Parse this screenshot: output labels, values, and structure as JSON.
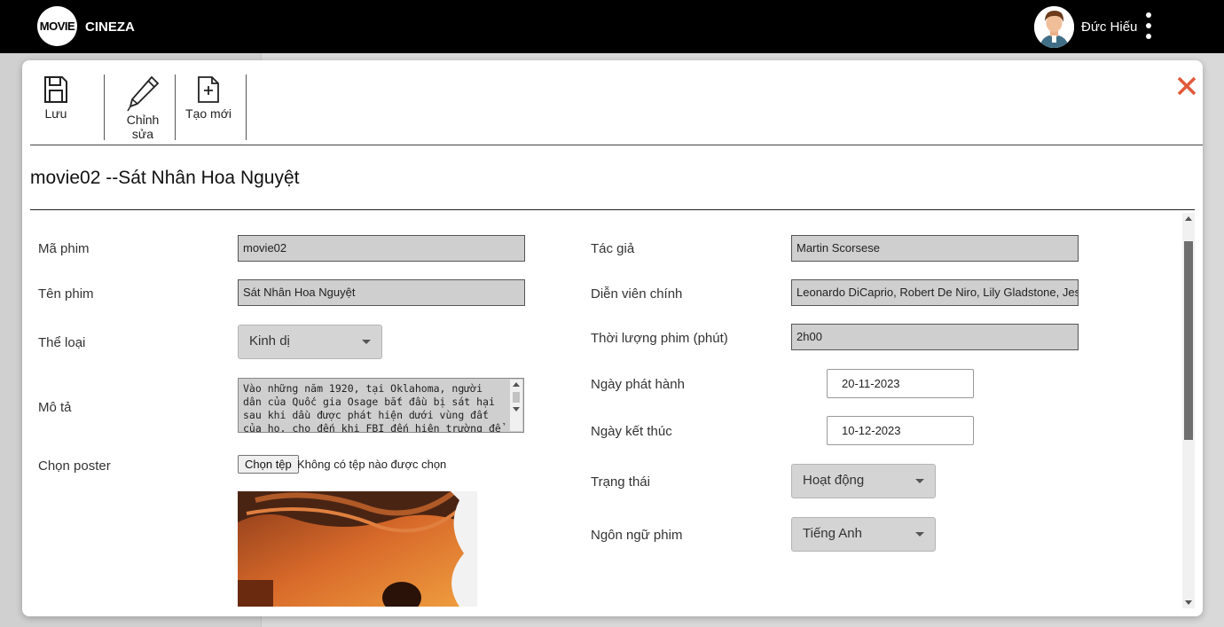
{
  "header": {
    "logo_text": "MOVIE",
    "brand": "CINEZA",
    "username": "Đức Hiếu",
    "avatar_icon": "user-avatar",
    "menu_icon": "kebab-menu-icon"
  },
  "toolbar": {
    "save_label": "Lưu",
    "edit_label": "Chỉnh sửa",
    "new_label": "Tạo mới",
    "close_icon": "close-icon",
    "close_color": "#e05a3a"
  },
  "title": "movie02 --Sát Nhân Hoa Nguyệt",
  "form": {
    "ma_phim_label": "Mã phim",
    "ma_phim_value": "movie02",
    "ten_phim_label": "Tên phim",
    "ten_phim_value": "Sát Nhân Hoa Nguyệt",
    "the_loai_label": "Thể loại",
    "the_loai_value": "Kinh dị",
    "mo_ta_label": "Mô tả",
    "mo_ta_value": "Vào những năm 1920, tại Oklahoma, người dân của Quốc gia Osage bắt đầu bị sát hại sau khi dầu được phát hiện dưới vùng đất của họ, cho đến khi FBI đến hiện trường để giải",
    "poster_label": "Chọn poster",
    "poster_button": "Chọn tệp",
    "poster_status": "Không có tệp nào được chọn",
    "tac_gia_label": "Tác giả",
    "tac_gia_value": "Martin Scorsese",
    "dien_vien_label": "Diễn viên chính",
    "dien_vien_value": "Leonardo DiCaprio, Robert De Niro, Lily Gladstone, Jesse",
    "thoi_luong_label": "Thời lượng phim (phút)",
    "thoi_luong_value": "2h00",
    "ngay_phat_hanh_label": "Ngày phát hành",
    "ngay_phat_hanh_value": "20-11-2023",
    "ngay_ket_thuc_label": "Ngày kết thúc",
    "ngay_ket_thuc_value": "10-12-2023",
    "trang_thai_label": "Trạng thái",
    "trang_thai_value": "Hoạt động",
    "ngon_ngu_label": "Ngôn ngữ phim",
    "ngon_ngu_value": "Tiếng Anh"
  }
}
